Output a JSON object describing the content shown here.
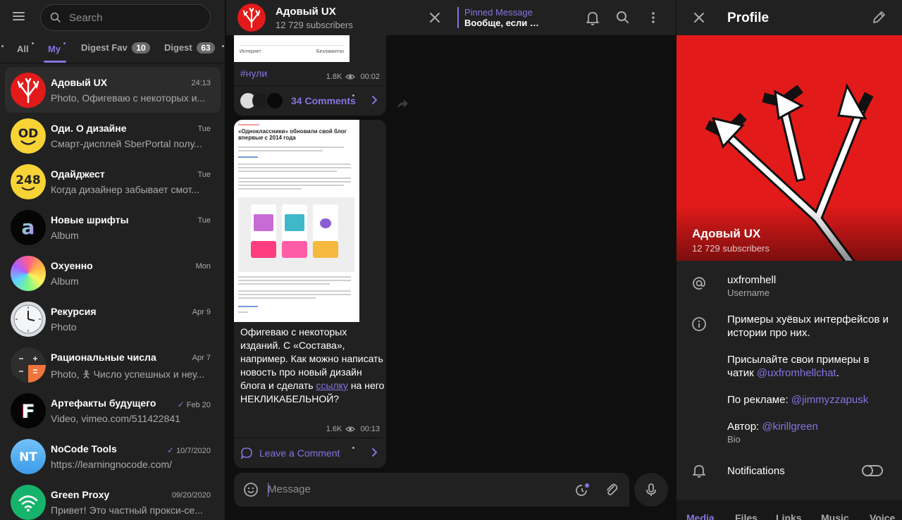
{
  "accent": "#8774e1",
  "sidebar": {
    "search_placeholder": "Search",
    "filters": [
      {
        "label": "All"
      },
      {
        "label": "My",
        "active": true
      },
      {
        "label": "Digest Fav",
        "count": "10"
      },
      {
        "label": "Digest",
        "count": "63"
      }
    ],
    "chats": [
      {
        "name": "Адовый UX",
        "time": "24:13",
        "preview": "Photo, Офигеваю с некоторых и...",
        "active": true,
        "avatar": "trident"
      },
      {
        "name": "Оди. О дизайне",
        "time": "Tue",
        "preview": "Смарт-дисплей SberPortal полу...",
        "avatar": "od"
      },
      {
        "name": "Одайджест",
        "time": "Tue",
        "preview": "Когда дизайнер забывает смот...",
        "avatar": "248"
      },
      {
        "name": "Новые шрифты",
        "time": "Tue",
        "preview": "Album",
        "avatar": "a"
      },
      {
        "name": "Охуенно",
        "time": "Mon",
        "preview": "Album",
        "avatar": "gradient"
      },
      {
        "name": "Рекурсия",
        "time": "Apr 9",
        "preview": "Photo",
        "avatar": "clock"
      },
      {
        "name": "Рациональные числа",
        "time": "Apr 7",
        "preview": "Photo, 🯅 Число успешных и неу...",
        "avatar": "calc"
      },
      {
        "name": "Артефакты будущего",
        "time": "Feb 20",
        "preview": "Video, vimeo.com/511422841",
        "read": true,
        "avatar": "f"
      },
      {
        "name": "NoCode Tools",
        "time": "10/7/2020",
        "preview": "https://learningnocode.com/",
        "read": true,
        "avatar": "nt"
      },
      {
        "name": "Green Proxy",
        "time": "09/20/2020",
        "preview": "Привет! Это частный прокси-се...",
        "avatar": "wifi"
      }
    ]
  },
  "header": {
    "title": "Адовый UX",
    "subscribers": "12 729 subscribers",
    "pinned_label": "Pinned Message",
    "pinned_text": "Вообще, если п..."
  },
  "messages": {
    "first": {
      "img_left": "Интернет",
      "img_right": "Безлимитно",
      "hashtag": "#нули",
      "views": "1.8K",
      "time": "00:02",
      "comments": "34 Comments"
    },
    "second": {
      "doc_title": "«Одноклассники» обновили свой блог впервые с 2014 года",
      "text_before": "Офигеваю с некоторых изданий. С «Состава», например. Как можно написать новость про новый дизайн блога и сделать ",
      "link": "ссылку",
      "text_after": " на него НЕКЛИКАБЕЛЬНОЙ?",
      "views": "1.6K",
      "time": "00:13",
      "comment_cta": "Leave a Comment"
    }
  },
  "composer": {
    "placeholder": "Message"
  },
  "profile": {
    "title": "Profile",
    "name": "Адовый UX",
    "subscribers": "12 729 subscribers",
    "username": "uxfromhell",
    "username_caption": "Username",
    "bio_line1": "Примеры хуёвых интерфейсов и истории про них.",
    "bio_line2_prefix": "Присылайте свои примеры в чатик ",
    "bio_line2_link": "@uxfromhellchat",
    "bio_line2_suffix": ".",
    "ads_prefix": "По рекламе: ",
    "ads_link": "@jimmyzzapusk",
    "author_prefix": "Автор: ",
    "author_link": "@kirillgreen",
    "bio_caption": "Bio",
    "notifications": "Notifications",
    "notifications_on": false,
    "tabs": [
      "Media",
      "Files",
      "Links",
      "Music",
      "Voice"
    ]
  }
}
